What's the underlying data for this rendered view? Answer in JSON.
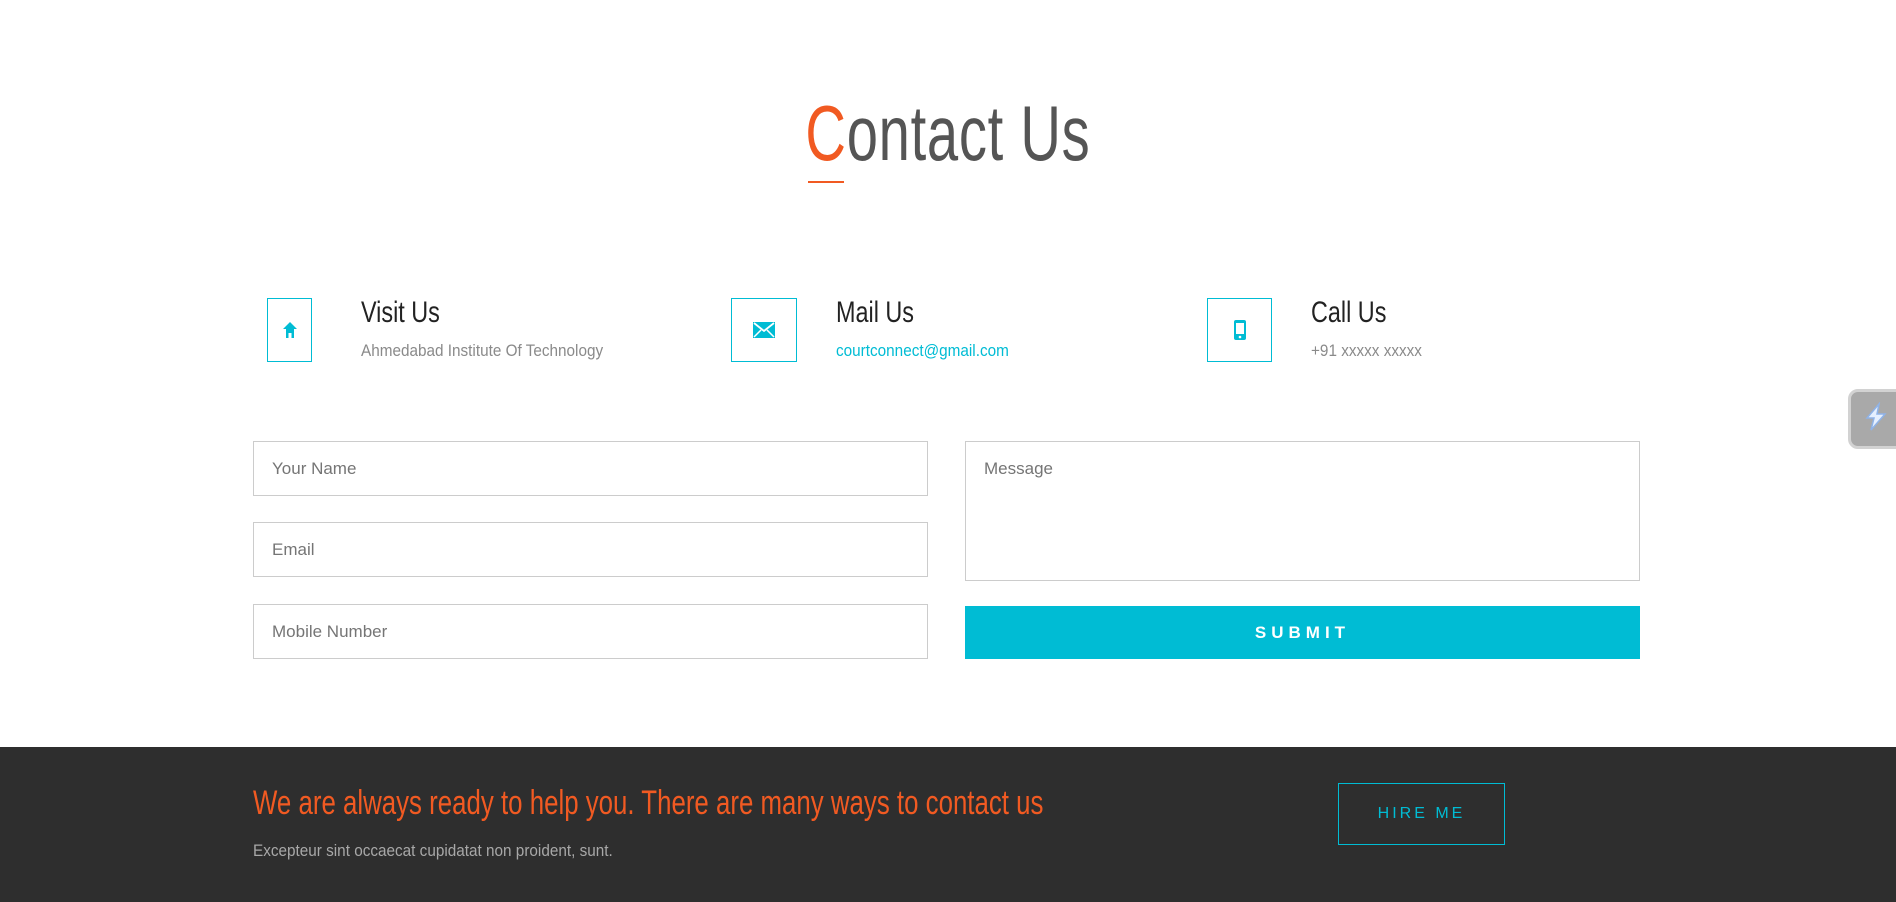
{
  "header": {
    "title_first_letter": "C",
    "title_rest": "ontact Us"
  },
  "contact_info": {
    "visit": {
      "title": "Visit Us",
      "detail": "Ahmedabad Institute Of Technology",
      "icon": "home-icon"
    },
    "mail": {
      "title": "Mail Us",
      "detail": "courtconnect@gmail.com",
      "icon": "envelope-icon"
    },
    "call": {
      "title": "Call Us",
      "detail": "+91 xxxxx xxxxx",
      "icon": "phone-icon"
    }
  },
  "form": {
    "name_placeholder": "Your Name",
    "email_placeholder": "Email",
    "mobile_placeholder": "Mobile Number",
    "message_placeholder": "Message",
    "submit_label": "SUBMIT"
  },
  "footer": {
    "heading": "We are always ready to help you. There are many ways to contact us",
    "subtext": "Excepteur sint occaecat cupidatat non proident, sunt.",
    "hire_label": "HIRE ME"
  },
  "colors": {
    "accent_orange": "#f15a22",
    "accent_cyan": "#00bcd4",
    "footer_bg": "#2e2e2e"
  }
}
